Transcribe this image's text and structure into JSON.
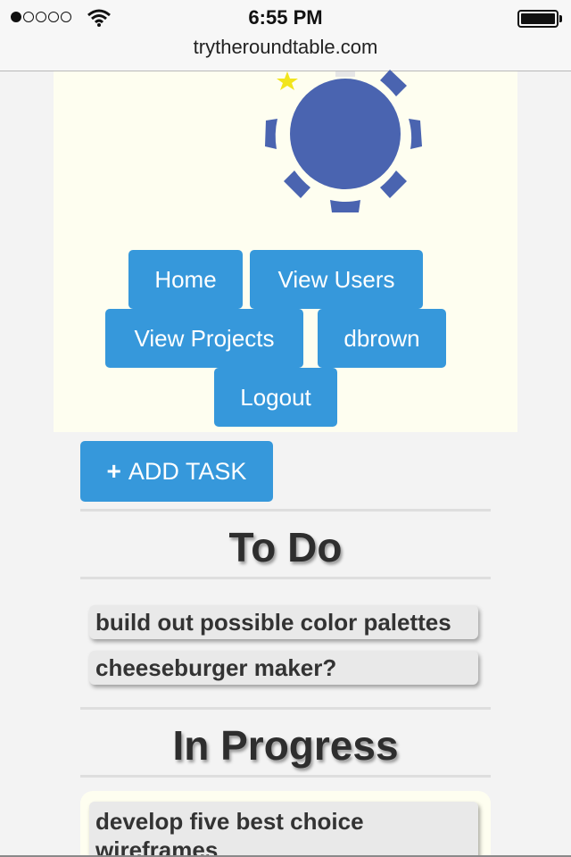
{
  "status_bar": {
    "time": "6:55 PM",
    "signal_dots_filled": 1,
    "signal_dots_total": 5,
    "battery_level": 1.0
  },
  "browser": {
    "url": "trytheroundtable.com"
  },
  "colors": {
    "accent": "#3698db",
    "logo": "#4a64b0",
    "star": "#f2e51d",
    "header_bg": "#fefef0"
  },
  "logo": {
    "icon": "sun-logo-icon",
    "star_icon": "star-icon"
  },
  "nav": {
    "home": "Home",
    "view_users": "View Users",
    "view_projects": "View Projects",
    "user": "dbrown",
    "logout": "Logout"
  },
  "actions": {
    "add_task_icon": "plus-icon",
    "add_task_label": "ADD TASK"
  },
  "sections": {
    "todo": {
      "title": "To Do",
      "tasks": [
        "build out possible color palettes",
        "cheeseburger maker?"
      ]
    },
    "in_progress": {
      "title": "In Progress",
      "tasks": [
        "develop five best choice wireframes"
      ]
    }
  }
}
